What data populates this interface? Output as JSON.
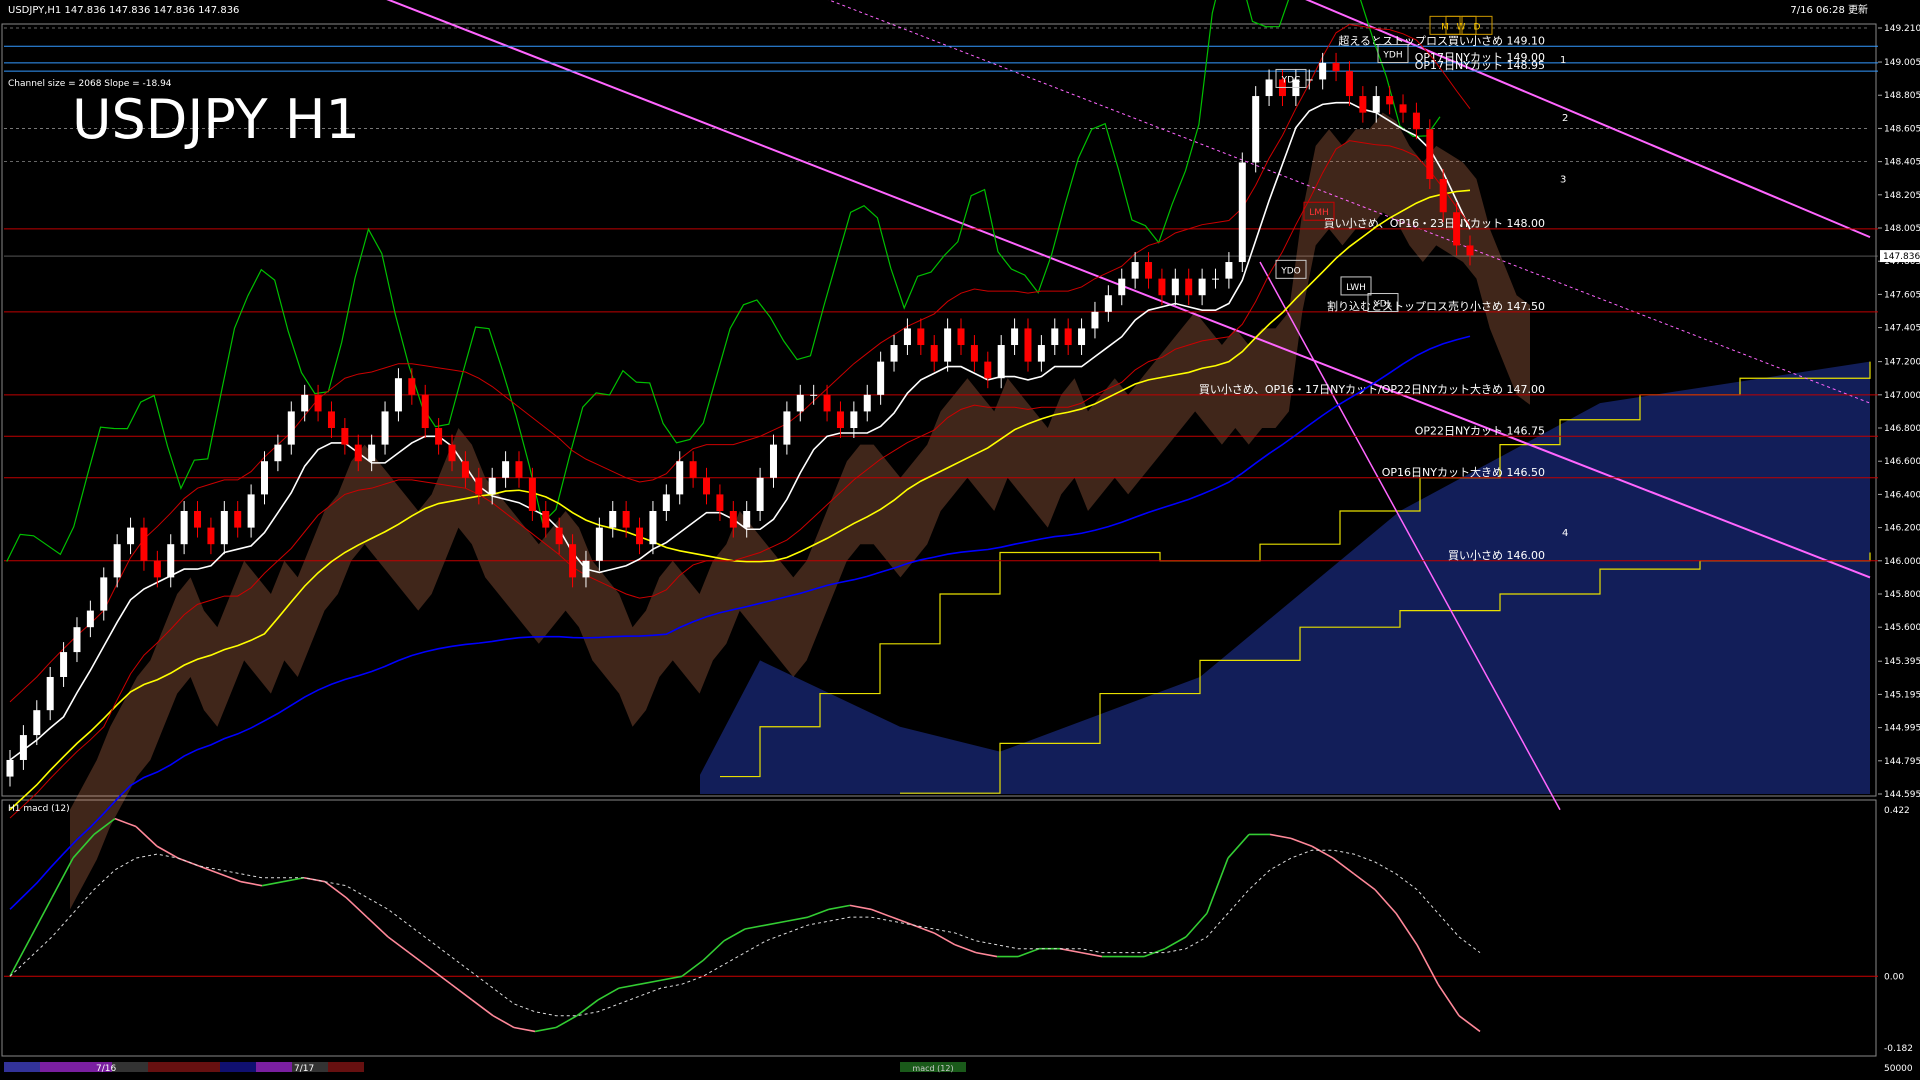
{
  "header": {
    "symbol_info": "USDJPY,H1  147.836 147.836 147.836 147.836",
    "updated": "7/16 06:28 更新",
    "channel_info": "Channel size = 2068 Slope = -18.94",
    "big_title": "USDJPY H1"
  },
  "macd_label": "H1  macd (12)",
  "footer": {
    "dates": [
      "7/16",
      "7/17"
    ],
    "indicator_tab": "macd (12)",
    "right_value": "50000"
  },
  "colors": {
    "background": "#000000",
    "up_candle": "#ffffff",
    "down_candle": "#ff0000",
    "ma_fast": "#ffffff",
    "ma_mid": "#ffff00",
    "ma_slow": "#0000ff",
    "chikou": "#00c000",
    "trend_line": "#ff66ff",
    "level_line": "#c00000",
    "cloud_up": "#ff9966",
    "cloud_down": "#3355ff",
    "macd_up": "#33cc33",
    "macd_down": "#ff8899",
    "macd_signal": "#dddddd"
  },
  "chart_data": [
    {
      "type": "candlestick",
      "title": "USDJPY H1",
      "y_ticks": [
        "149.210",
        "149.005",
        "148.805",
        "148.605",
        "148.405",
        "148.205",
        "148.005",
        "147.805",
        "147.605",
        "147.405",
        "147.200",
        "147.000",
        "146.800",
        "146.600",
        "146.400",
        "146.200",
        "146.000",
        "145.800",
        "145.600",
        "145.395",
        "145.195",
        "144.995",
        "144.795",
        "144.595"
      ],
      "ylim": [
        144.595,
        149.21
      ],
      "current_price": "147.836",
      "levels": [
        {
          "price": 149.1,
          "label": "超えるとストップロス買い小さめ 149.10"
        },
        {
          "price": 149.0,
          "label": "OP17日NYカット 149.00"
        },
        {
          "price": 148.95,
          "label": "OP17日NYカット 148.95"
        },
        {
          "price": 148.0,
          "label": "買い小さめ、OP16・23日NYカット 148.00"
        },
        {
          "price": 147.5,
          "label": "割り込むとストップロス売り小さめ 147.50"
        },
        {
          "price": 147.0,
          "label": "買い小さめ、OP16・17日NYカット/OP22日NYカット大きめ 147.00"
        },
        {
          "price": 146.75,
          "label": "OP22日NYカット 146.75"
        },
        {
          "price": 146.5,
          "label": "OP16日NYカット大きめ 146.50"
        },
        {
          "price": 146.0,
          "label": "買い小さめ 146.00"
        }
      ],
      "box_labels": [
        "YDH",
        "YDC",
        "YDO",
        "LWH",
        "LMH",
        "YDL",
        "M",
        "W",
        "D"
      ],
      "wave_labels": [
        "1",
        "2",
        "3",
        "4"
      ],
      "close_series": [
        144.8,
        144.95,
        145.1,
        145.3,
        145.45,
        145.6,
        145.7,
        145.9,
        146.1,
        146.2,
        146.0,
        145.9,
        146.1,
        146.3,
        146.2,
        146.1,
        146.3,
        146.2,
        146.4,
        146.6,
        146.7,
        146.9,
        147.0,
        146.9,
        146.8,
        146.7,
        146.6,
        146.7,
        146.9,
        147.1,
        147.0,
        146.8,
        146.7,
        146.6,
        146.5,
        146.4,
        146.5,
        146.6,
        146.5,
        146.3,
        146.2,
        146.1,
        145.9,
        146.0,
        146.2,
        146.3,
        146.2,
        146.1,
        146.3,
        146.4,
        146.6,
        146.5,
        146.4,
        146.3,
        146.2,
        146.3,
        146.5,
        146.7,
        146.9,
        147.0,
        147.0,
        146.9,
        146.8,
        146.9,
        147.0,
        147.2,
        147.3,
        147.4,
        147.3,
        147.2,
        147.4,
        147.3,
        147.2,
        147.1,
        147.3,
        147.4,
        147.2,
        147.3,
        147.4,
        147.3,
        147.4,
        147.5,
        147.6,
        147.7,
        147.8,
        147.7,
        147.6,
        147.7,
        147.6,
        147.7,
        147.7,
        147.8,
        148.4,
        148.8,
        148.9,
        148.8,
        148.9,
        148.9,
        149.0,
        148.95,
        148.8,
        148.7,
        148.8,
        148.75,
        148.7,
        148.6,
        148.3,
        148.1,
        147.9,
        147.84
      ],
      "macd": {
        "y_ticks": [
          "0.422",
          "0.00",
          "-0.182"
        ],
        "ylim": [
          -0.182,
          0.422
        ],
        "values": [
          0.0,
          0.1,
          0.2,
          0.3,
          0.36,
          0.4,
          0.38,
          0.33,
          0.3,
          0.28,
          0.26,
          0.24,
          0.23,
          0.24,
          0.25,
          0.24,
          0.2,
          0.15,
          0.1,
          0.06,
          0.02,
          -0.02,
          -0.06,
          -0.1,
          -0.13,
          -0.14,
          -0.13,
          -0.1,
          -0.06,
          -0.03,
          -0.02,
          -0.01,
          0.0,
          0.04,
          0.09,
          0.12,
          0.13,
          0.14,
          0.15,
          0.17,
          0.18,
          0.17,
          0.15,
          0.13,
          0.11,
          0.08,
          0.06,
          0.05,
          0.05,
          0.07,
          0.07,
          0.06,
          0.05,
          0.05,
          0.05,
          0.07,
          0.1,
          0.16,
          0.3,
          0.36,
          0.36,
          0.35,
          0.33,
          0.3,
          0.26,
          0.22,
          0.16,
          0.08,
          -0.02,
          -0.1,
          -0.14
        ],
        "signal": [
          0.0,
          0.05,
          0.1,
          0.16,
          0.22,
          0.27,
          0.3,
          0.31,
          0.3,
          0.28,
          0.27,
          0.26,
          0.25,
          0.25,
          0.25,
          0.24,
          0.23,
          0.2,
          0.17,
          0.13,
          0.09,
          0.05,
          0.01,
          -0.03,
          -0.07,
          -0.09,
          -0.1,
          -0.1,
          -0.09,
          -0.07,
          -0.05,
          -0.03,
          -0.02,
          0.0,
          0.03,
          0.06,
          0.09,
          0.11,
          0.13,
          0.14,
          0.15,
          0.15,
          0.14,
          0.13,
          0.12,
          0.11,
          0.09,
          0.08,
          0.07,
          0.07,
          0.07,
          0.07,
          0.06,
          0.06,
          0.06,
          0.06,
          0.07,
          0.1,
          0.16,
          0.22,
          0.27,
          0.3,
          0.32,
          0.32,
          0.31,
          0.29,
          0.26,
          0.22,
          0.16,
          0.1,
          0.06
        ]
      }
    }
  ]
}
